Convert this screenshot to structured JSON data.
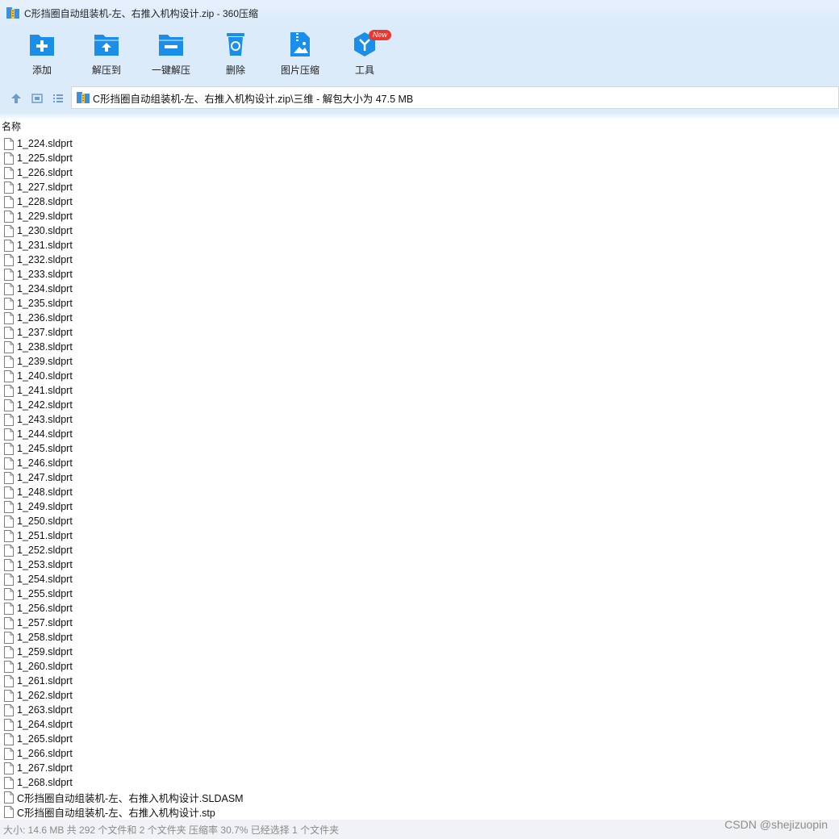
{
  "window": {
    "title": "C形挡圈自动组装机-左、右推入机构设计.zip - 360压缩"
  },
  "toolbar": {
    "add": "添加",
    "extract_to": "解压到",
    "one_click_extract": "一键解压",
    "delete": "删除",
    "image_compress": "图片压缩",
    "tools": "工具",
    "new_badge": "New"
  },
  "address": {
    "path": "C形挡圈自动组装机-左、右推入机构设计.zip\\三维 - 解包大小为 47.5 MB"
  },
  "columns": {
    "name": "名称"
  },
  "files": [
    "1_224.sldprt",
    "1_225.sldprt",
    "1_226.sldprt",
    "1_227.sldprt",
    "1_228.sldprt",
    "1_229.sldprt",
    "1_230.sldprt",
    "1_231.sldprt",
    "1_232.sldprt",
    "1_233.sldprt",
    "1_234.sldprt",
    "1_235.sldprt",
    "1_236.sldprt",
    "1_237.sldprt",
    "1_238.sldprt",
    "1_239.sldprt",
    "1_240.sldprt",
    "1_241.sldprt",
    "1_242.sldprt",
    "1_243.sldprt",
    "1_244.sldprt",
    "1_245.sldprt",
    "1_246.sldprt",
    "1_247.sldprt",
    "1_248.sldprt",
    "1_249.sldprt",
    "1_250.sldprt",
    "1_251.sldprt",
    "1_252.sldprt",
    "1_253.sldprt",
    "1_254.sldprt",
    "1_255.sldprt",
    "1_256.sldprt",
    "1_257.sldprt",
    "1_258.sldprt",
    "1_259.sldprt",
    "1_260.sldprt",
    "1_261.sldprt",
    "1_262.sldprt",
    "1_263.sldprt",
    "1_264.sldprt",
    "1_265.sldprt",
    "1_266.sldprt",
    "1_267.sldprt",
    "1_268.sldprt",
    "C形挡圈自动组装机-左、右推入机构设计.SLDASM",
    "C形挡圈自动组装机-左、右推入机构设计.stp"
  ],
  "status": {
    "text": "大小: 14.6 MB 共 292 个文件和 2 个文件夹 压缩率 30.7% 已经选择 1 个文件夹"
  },
  "watermark": "CSDN @shejizuopin",
  "colors": {
    "icon_blue": "#1a8ee8",
    "toolbar_bg": "#dcebfa",
    "badge_red": "#e8382f"
  }
}
